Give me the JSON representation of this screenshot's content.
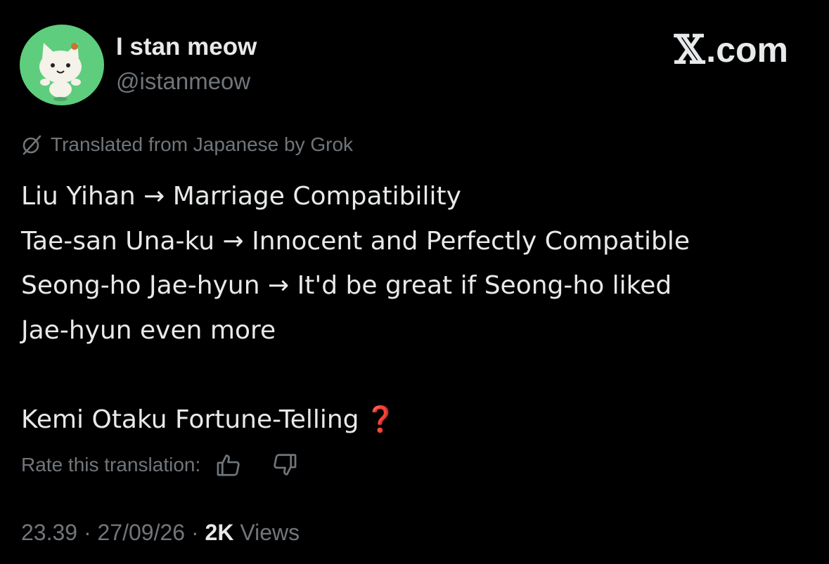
{
  "author": {
    "display_name": "I stan meow",
    "handle": "@istanmeow",
    "avatar_icon": "cat-avatar-icon",
    "avatar_bg": "#5ecd7d"
  },
  "brand": {
    "mark": "𝕏",
    "suffix": ".com"
  },
  "translation": {
    "icon": "grok-icon",
    "notice": "Translated from Japanese by Grok"
  },
  "tweet": {
    "lines": [
      "Liu Yihan → Marriage Compatibility",
      "Tae-san Una-ku → Innocent and Perfectly Compatible",
      "Seong-ho Jae-hyun → It'd be great if Seong-ho liked",
      "Jae-hyun even more"
    ],
    "closing": "Kemi Otaku Fortune-Telling",
    "closing_emoji": "❓"
  },
  "rating": {
    "label": "Rate this translation:",
    "up_icon": "thumbs-up-icon",
    "down_icon": "thumbs-down-icon"
  },
  "meta": {
    "time": "23.39",
    "separator": " · ",
    "date": "27/09/26",
    "views_count": "2K",
    "views_label": "Views"
  },
  "colors": {
    "background": "#000000",
    "primary_text": "#e7e9ea",
    "secondary_text": "#71767b",
    "emoji_red": "#e0245e"
  }
}
